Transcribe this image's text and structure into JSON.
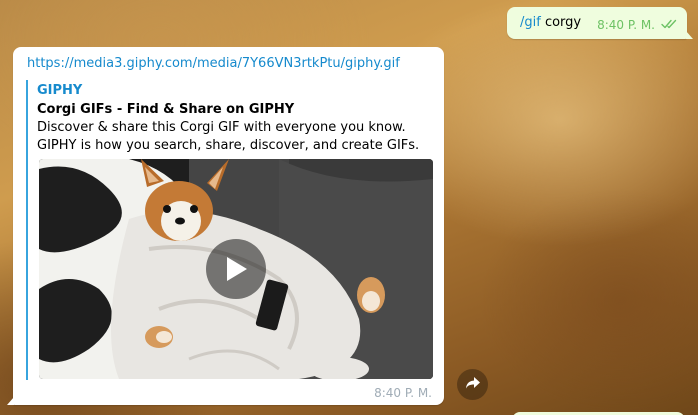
{
  "outgoing_message": {
    "command": "/gif",
    "text": " corgy",
    "time": "8:40 P. M.",
    "status_icon": "double-check-icon"
  },
  "incoming_message": {
    "url": "https://media3.giphy.com/media/7Y66VN3rtkPtu/giphy.gif",
    "preview": {
      "site_name": "GIPHY",
      "title": "Corgi GIFs - Find & Share on GIPHY",
      "description": "Discover & share this Corgi GIF with everyone you know. GIPHY is how you search, share, discover, and create GIFs."
    },
    "media_icon": "play-icon",
    "time": "8:40 P. M."
  },
  "actions": {
    "forward_icon": "forward-icon"
  },
  "colors": {
    "outgoing_bubble": "#effdde",
    "incoming_bubble": "#ffffff",
    "link": "#168acd",
    "check": "#6dc264",
    "accent_bar": "#37a4de"
  }
}
